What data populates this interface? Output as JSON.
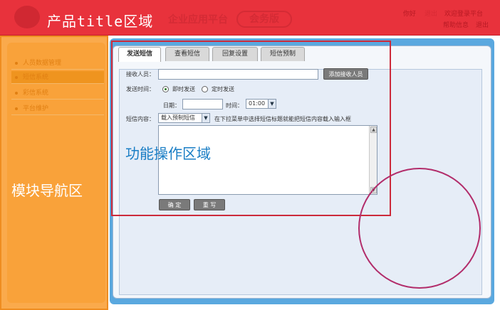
{
  "header": {
    "region_title": "产品title区域",
    "app_name": "企业应用平台",
    "edition": "会务版",
    "links": [
      "你好",
      "退出",
      "欢迎登录平台",
      "帮助信息",
      "退出"
    ]
  },
  "sidebar": {
    "region_title": "模块导航区",
    "items": [
      {
        "label": "人员数据管理"
      },
      {
        "label": "短信系统"
      },
      {
        "label": "彩信系统"
      },
      {
        "label": "平台维护"
      }
    ],
    "active_index": 1
  },
  "main": {
    "region_title": "功能操作区域",
    "tabs": [
      {
        "label": "发送短信",
        "active": true
      },
      {
        "label": "查看短信",
        "active": false
      },
      {
        "label": "回复设置",
        "active": false
      },
      {
        "label": "短信预制",
        "active": false
      }
    ],
    "form": {
      "recipient_label": "接收人员：",
      "recipient_value": "",
      "add_recipient_button": "添加接收人员",
      "send_time_label": "发送时间：",
      "send_time_options": [
        "即时发送",
        "定时发送"
      ],
      "send_time_selected": "即时发送",
      "date_label": "日期：",
      "date_value": "",
      "time_label": "时间：",
      "time_value": "01:00",
      "content_label": "短信内容：",
      "preset_select": "载入预制短信",
      "preset_hint": "在下拉菜单中选择短信标题就能把短信内容载入输入框",
      "content_value": "",
      "confirm_button": "确 定",
      "reset_button": "重 写"
    }
  },
  "colors": {
    "header_bg": "#e8323c",
    "sidebar_bg": "#faaa4c",
    "main_frame": "#5aa8df",
    "annotation_rect": "#cc2a3a",
    "annotation_circle": "#b22c6a",
    "function_text": "#1a7ec5"
  }
}
